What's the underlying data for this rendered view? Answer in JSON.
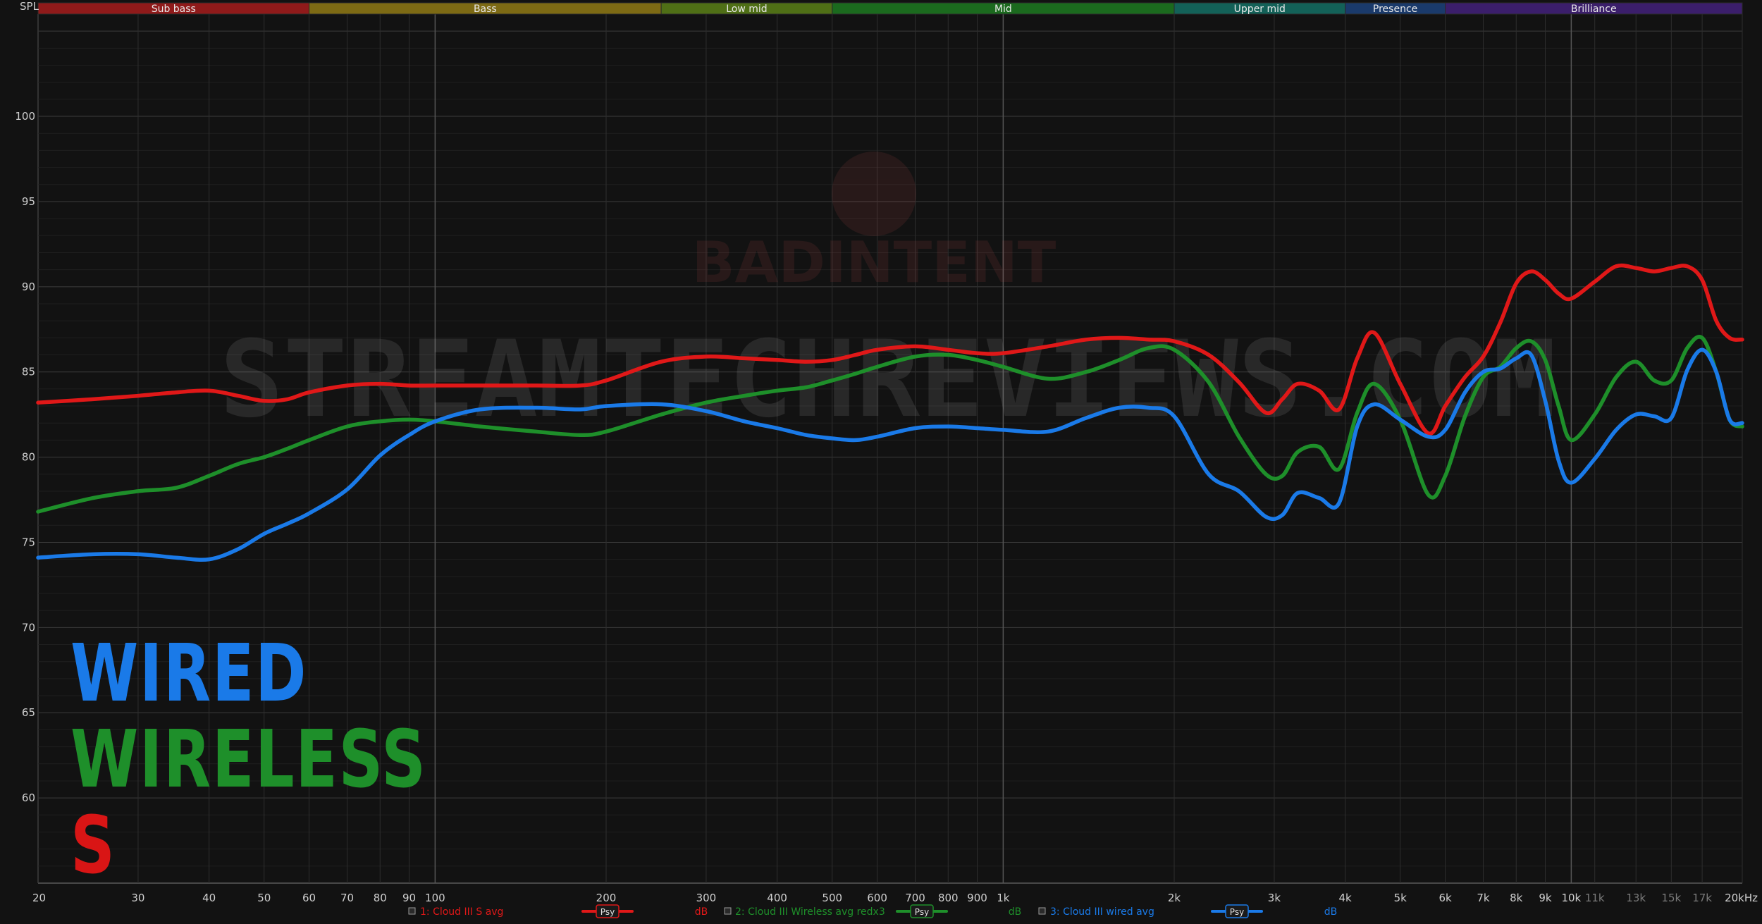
{
  "chart_data": {
    "type": "line",
    "ylabel": "SPL",
    "ylim": [
      55,
      106
    ],
    "xlim": [
      20,
      20000
    ],
    "x_scale": "log",
    "grid": true,
    "yticks": [
      60,
      65,
      70,
      75,
      80,
      85,
      90,
      95,
      100
    ],
    "xticks": [
      {
        "value": 20,
        "label": "20"
      },
      {
        "value": 30,
        "label": "30"
      },
      {
        "value": 40,
        "label": "40"
      },
      {
        "value": 50,
        "label": "50"
      },
      {
        "value": 60,
        "label": "60"
      },
      {
        "value": 70,
        "label": "70"
      },
      {
        "value": 80,
        "label": "80"
      },
      {
        "value": 90,
        "label": "90"
      },
      {
        "value": 100,
        "label": "100"
      },
      {
        "value": 200,
        "label": "200"
      },
      {
        "value": 300,
        "label": "300"
      },
      {
        "value": 400,
        "label": "400"
      },
      {
        "value": 500,
        "label": "500"
      },
      {
        "value": 600,
        "label": "600"
      },
      {
        "value": 700,
        "label": "700"
      },
      {
        "value": 800,
        "label": "800"
      },
      {
        "value": 900,
        "label": "900"
      },
      {
        "value": 1000,
        "label": "1k"
      },
      {
        "value": 2000,
        "label": "2k"
      },
      {
        "value": 3000,
        "label": "3k"
      },
      {
        "value": 4000,
        "label": "4k"
      },
      {
        "value": 5000,
        "label": "5k"
      },
      {
        "value": 6000,
        "label": "6k"
      },
      {
        "value": 7000,
        "label": "7k"
      },
      {
        "value": 8000,
        "label": "8k"
      },
      {
        "value": 9000,
        "label": "9k"
      },
      {
        "value": 10000,
        "label": "10k"
      },
      {
        "value": 11000,
        "label": "11k",
        "dim": true
      },
      {
        "value": 13000,
        "label": "13k",
        "dim": true
      },
      {
        "value": 15000,
        "label": "15k",
        "dim": true
      },
      {
        "value": 17000,
        "label": "17k",
        "dim": true
      },
      {
        "value": 20000,
        "label": "20kHz"
      }
    ],
    "bands": [
      {
        "label": "Sub bass",
        "from": 20,
        "to": 60,
        "color": "#8f1a1a"
      },
      {
        "label": "Bass",
        "from": 60,
        "to": 250,
        "color": "#7d6a14"
      },
      {
        "label": "Low mid",
        "from": 250,
        "to": 500,
        "color": "#4f6f16"
      },
      {
        "label": "Mid",
        "from": 500,
        "to": 2000,
        "color": "#1b6a1e"
      },
      {
        "label": "Upper mid",
        "from": 2000,
        "to": 4000,
        "color": "#136158"
      },
      {
        "label": "Presence",
        "from": 4000,
        "to": 6000,
        "color": "#1a3a6b"
      },
      {
        "label": "Brilliance",
        "from": 6000,
        "to": 20000,
        "color": "#3b1e6b"
      }
    ],
    "series": [
      {
        "name": "1: Cloud III S avg",
        "color": "#e01818",
        "x": [
          20,
          25,
          30,
          35,
          40,
          45,
          50,
          55,
          60,
          70,
          80,
          90,
          100,
          120,
          150,
          180,
          200,
          250,
          300,
          350,
          400,
          450,
          500,
          550,
          600,
          700,
          800,
          900,
          1000,
          1200,
          1400,
          1600,
          1800,
          2000,
          2300,
          2600,
          2900,
          3100,
          3300,
          3600,
          3900,
          4200,
          4500,
          5000,
          5600,
          6000,
          6500,
          7000,
          7500,
          8000,
          8500,
          9000,
          9500,
          10000,
          11000,
          12000,
          13000,
          14000,
          15000,
          16000,
          17000,
          18000,
          19000,
          20000
        ],
        "values": [
          83.2,
          83.4,
          83.6,
          83.8,
          83.9,
          83.6,
          83.3,
          83.4,
          83.8,
          84.2,
          84.3,
          84.2,
          84.2,
          84.2,
          84.2,
          84.2,
          84.5,
          85.6,
          85.9,
          85.8,
          85.7,
          85.6,
          85.7,
          86.0,
          86.3,
          86.5,
          86.3,
          86.1,
          86.1,
          86.5,
          86.9,
          87.0,
          86.9,
          86.8,
          86.0,
          84.4,
          82.6,
          83.4,
          84.3,
          83.9,
          82.8,
          85.8,
          87.3,
          84.3,
          81.4,
          83.0,
          84.7,
          85.9,
          87.9,
          90.2,
          90.9,
          90.4,
          89.6,
          89.3,
          90.3,
          91.2,
          91.1,
          90.9,
          91.1,
          91.2,
          90.4,
          88.0,
          87.0,
          86.9
        ]
      },
      {
        "name": "2: Cloud III Wireless avg redx3",
        "color": "#1e8f2a",
        "x": [
          20,
          25,
          30,
          35,
          40,
          45,
          50,
          55,
          60,
          70,
          80,
          90,
          100,
          120,
          150,
          180,
          200,
          250,
          300,
          350,
          400,
          450,
          500,
          550,
          600,
          700,
          800,
          900,
          1000,
          1200,
          1400,
          1600,
          1800,
          2000,
          2300,
          2600,
          2900,
          3100,
          3300,
          3600,
          3900,
          4200,
          4500,
          5000,
          5600,
          6000,
          6500,
          7000,
          7500,
          8000,
          8500,
          9000,
          9500,
          10000,
          11000,
          12000,
          13000,
          14000,
          15000,
          16000,
          17000,
          18000,
          19000,
          20000
        ],
        "values": [
          76.8,
          77.6,
          78.0,
          78.2,
          78.9,
          79.6,
          80.0,
          80.5,
          81.0,
          81.8,
          82.1,
          82.2,
          82.1,
          81.8,
          81.5,
          81.3,
          81.5,
          82.5,
          83.2,
          83.6,
          83.9,
          84.1,
          84.5,
          84.9,
          85.3,
          85.9,
          86.0,
          85.7,
          85.3,
          84.6,
          85.0,
          85.7,
          86.4,
          86.3,
          84.4,
          81.2,
          79.0,
          78.9,
          80.3,
          80.6,
          79.3,
          82.6,
          84.3,
          82.2,
          77.8,
          78.9,
          82.4,
          84.7,
          85.3,
          86.4,
          86.8,
          85.7,
          83.0,
          81.0,
          82.5,
          84.7,
          85.6,
          84.5,
          84.5,
          86.4,
          87.0,
          85.0,
          82.2,
          81.8
        ]
      },
      {
        "name": "3: Cloud III wired avg",
        "color": "#1a7ae8",
        "x": [
          20,
          25,
          30,
          35,
          40,
          45,
          50,
          55,
          60,
          70,
          80,
          90,
          100,
          120,
          150,
          180,
          200,
          250,
          300,
          350,
          400,
          450,
          500,
          550,
          600,
          700,
          800,
          900,
          1000,
          1200,
          1400,
          1600,
          1800,
          2000,
          2300,
          2600,
          2900,
          3100,
          3300,
          3600,
          3900,
          4200,
          4500,
          5000,
          5600,
          6000,
          6500,
          7000,
          7500,
          8000,
          8500,
          9000,
          9500,
          10000,
          11000,
          12000,
          13000,
          14000,
          15000,
          16000,
          17000,
          18000,
          19000,
          20000
        ],
        "values": [
          74.1,
          74.3,
          74.3,
          74.1,
          74.0,
          74.6,
          75.5,
          76.1,
          76.7,
          78.1,
          80.1,
          81.3,
          82.1,
          82.8,
          82.9,
          82.8,
          83.0,
          83.1,
          82.7,
          82.1,
          81.7,
          81.3,
          81.1,
          81.0,
          81.2,
          81.7,
          81.8,
          81.7,
          81.6,
          81.5,
          82.3,
          82.9,
          82.9,
          82.4,
          79.0,
          78.0,
          76.5,
          76.6,
          77.9,
          77.6,
          77.3,
          81.8,
          83.1,
          82.2,
          81.2,
          81.6,
          83.8,
          85.0,
          85.2,
          85.8,
          86.0,
          83.3,
          79.8,
          78.5,
          79.9,
          81.6,
          82.5,
          82.4,
          82.3,
          85.1,
          86.3,
          85.0,
          82.2,
          82.0
        ]
      }
    ],
    "legend": {
      "placement": "bottom",
      "unit_label": "dB",
      "psy_label": "Psy"
    }
  },
  "watermark": {
    "site": "STREAMTECHREVIEWS.COM",
    "brand": "BADINTENT"
  },
  "overlay_labels": [
    {
      "text": "WIRED",
      "color": "#1a7ae8"
    },
    {
      "text": "WIRELESS",
      "color": "#1e8f2a"
    },
    {
      "text": "S",
      "color": "#d91515"
    }
  ]
}
